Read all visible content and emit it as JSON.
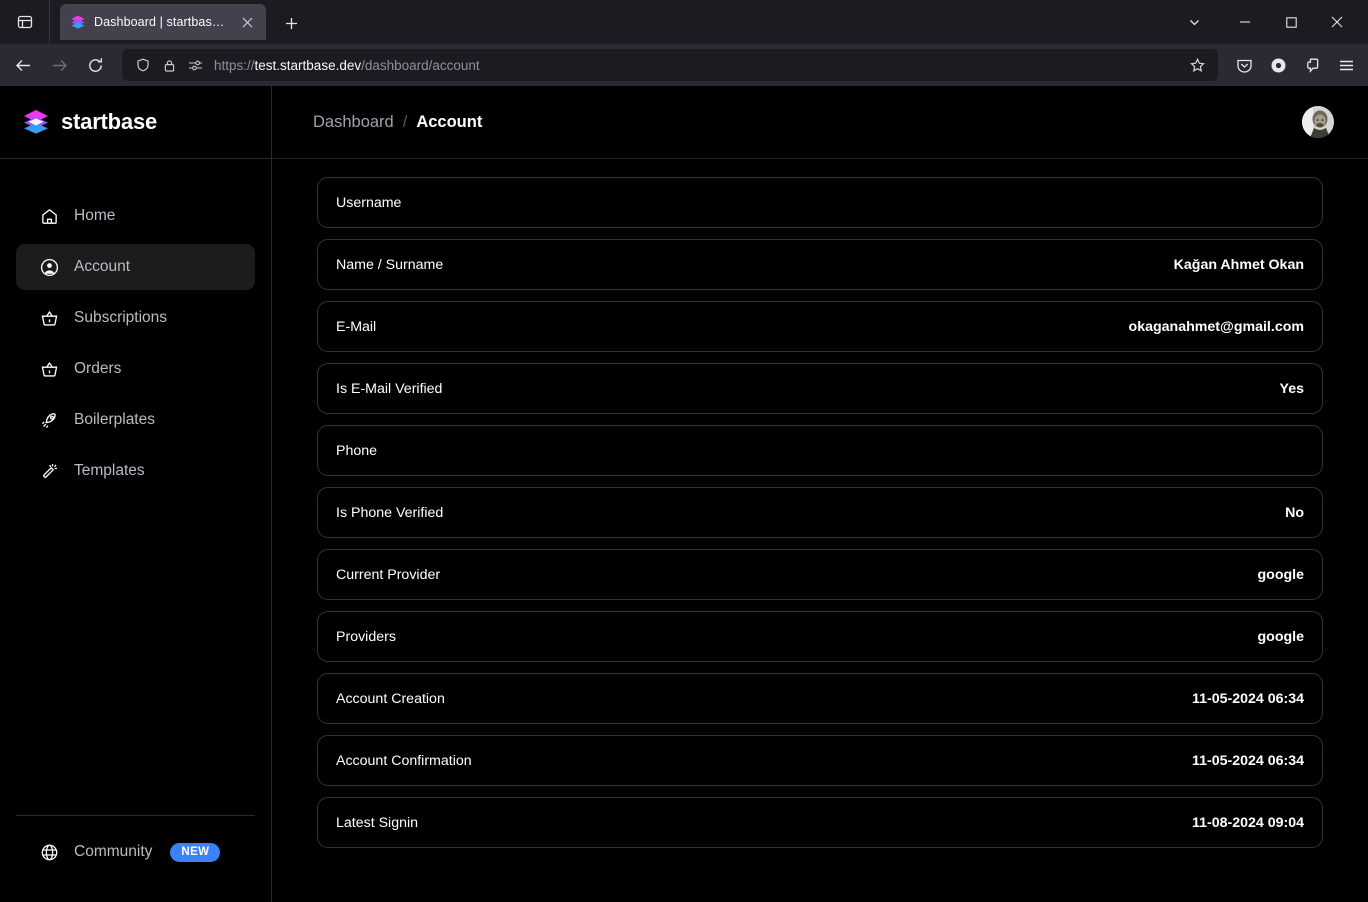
{
  "browser": {
    "tab": {
      "title": "Dashboard | startbase.dev",
      "favicon_icon": "layers-stack-icon",
      "close_icon": "close-icon"
    },
    "new_tab_label": "+",
    "tab_list_icon": "tab-list-icon",
    "window_controls": {
      "tab_dropdown_icon": "chevron-down-icon",
      "minimize_icon": "minimize-icon",
      "maximize_icon": "maximize-icon",
      "close_icon": "close-icon"
    },
    "nav": {
      "back_icon": "back-arrow-icon",
      "forward_icon": "forward-arrow-icon",
      "reload_icon": "reload-icon"
    },
    "url": {
      "scheme": "https://",
      "host": "test.startbase.dev",
      "path": "/dashboard/account",
      "shield_icon": "shield-icon",
      "lock_icon": "lock-icon",
      "permissions_icon": "page-settings-icon",
      "bookmark_icon": "star-icon"
    },
    "toolbar": {
      "pocket_icon": "pocket-save-icon",
      "account_icon": "account-circle-icon",
      "extensions_icon": "extensions-icon",
      "menu_icon": "hamburger-menu-icon"
    }
  },
  "sidebar": {
    "brand": {
      "name": "startbase",
      "logo_icon": "layers-stack-icon"
    },
    "items": [
      {
        "label": "Home",
        "icon": "home-icon",
        "active": false
      },
      {
        "label": "Account",
        "icon": "user-circle-icon",
        "active": true
      },
      {
        "label": "Subscriptions",
        "icon": "basket-icon",
        "active": false
      },
      {
        "label": "Orders",
        "icon": "basket-icon",
        "active": false
      },
      {
        "label": "Boilerplates",
        "icon": "rocket-icon",
        "active": false
      },
      {
        "label": "Templates",
        "icon": "magic-wand-icon",
        "active": false
      }
    ],
    "footer": {
      "community_label": "Community",
      "community_icon": "globe-icon",
      "badge": "NEW"
    }
  },
  "header": {
    "breadcrumb": {
      "root": "Dashboard",
      "separator": "/",
      "current": "Account"
    },
    "avatar_name": "user-avatar"
  },
  "account": {
    "rows": [
      {
        "label": "Username",
        "value": ""
      },
      {
        "label": "Name / Surname",
        "value": "Kağan Ahmet Okan"
      },
      {
        "label": "E-Mail",
        "value": "okaganahmet@gmail.com"
      },
      {
        "label": "Is E-Mail Verified",
        "value": "Yes"
      },
      {
        "label": "Phone",
        "value": ""
      },
      {
        "label": "Is Phone Verified",
        "value": "No"
      },
      {
        "label": "Current Provider",
        "value": "google"
      },
      {
        "label": "Providers",
        "value": "google"
      },
      {
        "label": "Account Creation",
        "value": "11-05-2024 06:34"
      },
      {
        "label": "Account Confirmation",
        "value": "11-05-2024 06:34"
      },
      {
        "label": "Latest Signin",
        "value": "11-08-2024 09:04"
      }
    ]
  },
  "colors": {
    "accent_blue": "#3b82f6",
    "logo_magenta": "#e838f0",
    "logo_purple": "#8b5cf6",
    "logo_blue": "#3b9cf6",
    "page_background": "#000000",
    "row_border": "#333336"
  }
}
